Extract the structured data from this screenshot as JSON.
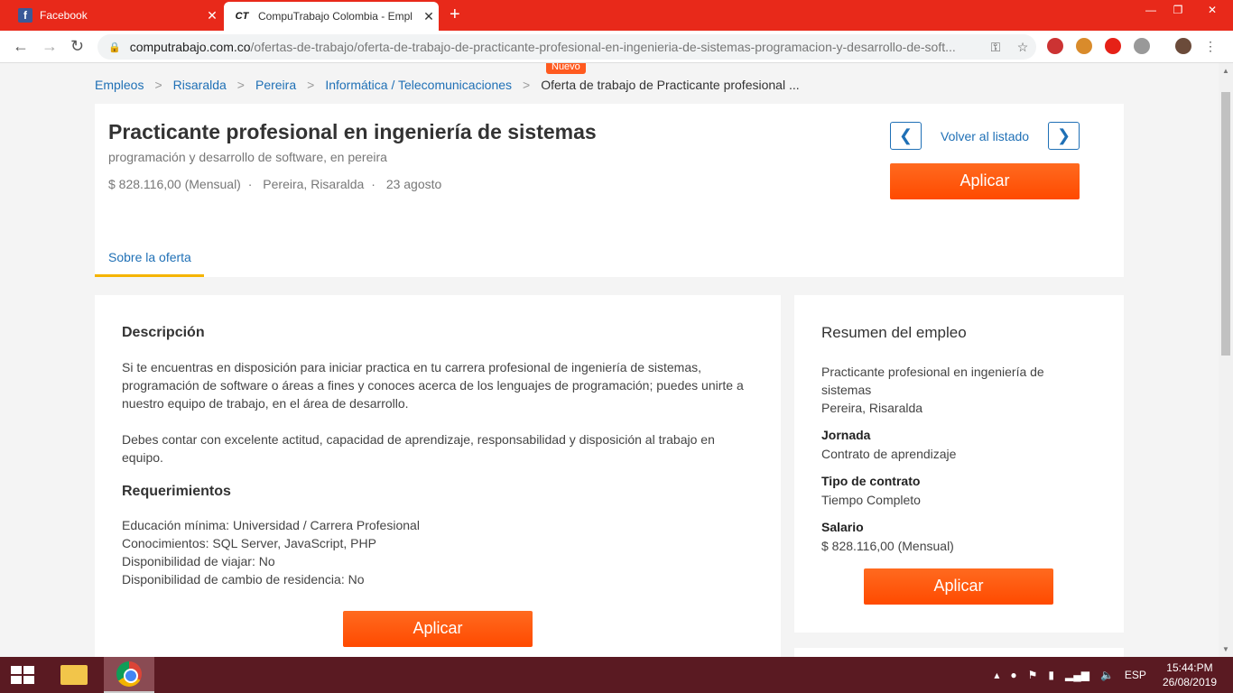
{
  "browser": {
    "tabs": [
      {
        "label": "Facebook",
        "favicon": "f"
      },
      {
        "label": "CompuTrabajo Colombia - Empl",
        "favicon": "CT"
      }
    ],
    "url_host": "computrabajo.com.co",
    "url_path": "/ofertas-de-trabajo/oferta-de-trabajo-de-practicante-profesional-en-ingenieria-de-sistemas-programacion-y-desarrollo-de-soft..."
  },
  "breadcrumb": {
    "items": [
      "Empleos",
      "Risaralda",
      "Pereira",
      "Informática / Telecomunicaciones"
    ],
    "current": "Oferta de trabajo de Practicante profesional ...",
    "badge": "Nuevo"
  },
  "job": {
    "title": "Practicante profesional en ingeniería de sistemas",
    "subtitle": "programación y desarrollo de software, en pereira",
    "salary": "$ 828.116,00 (Mensual)",
    "location": "Pereira, Risaralda",
    "date": "23 agosto",
    "sep": "·"
  },
  "nav": {
    "back_label": "Volver al listado"
  },
  "apply_label": "Aplicar",
  "tabs": {
    "about": "Sobre la oferta"
  },
  "description": {
    "heading": "Descripción",
    "p1": "Si te encuentras en disposición para iniciar practica en tu carrera profesional de ingeniería de sistemas, programación de software o áreas a fines y conoces acerca de los lenguajes de programación; puedes unirte a nuestro equipo de trabajo, en el área de desarrollo.",
    "p2": "Debes contar con excelente actitud, capacidad de aprendizaje, responsabilidad y disposición al trabajo en equipo.",
    "req_heading": "Requerimientos",
    "requirements": [
      "Educación mínima: Universidad / Carrera Profesional",
      "Conocimientos: SQL Server, JavaScript, PHP",
      "Disponibilidad de viajar: No",
      "Disponibilidad de cambio de residencia: No"
    ]
  },
  "summary": {
    "heading": "Resumen del empleo",
    "job": "Practicante profesional en ingeniería de sistemas",
    "location": "Pereira, Risaralda",
    "jornada_label": "Jornada",
    "jornada": "Contrato de aprendizaje",
    "contrato_label": "Tipo de contrato",
    "contrato": "Tiempo Completo",
    "salario_label": "Salario",
    "salario": "$ 828.116,00 (Mensual)"
  },
  "taskbar": {
    "lang": "ESP",
    "time": "15:44:PM",
    "date": "26/08/2019"
  },
  "colors": {
    "accent": "#ff5a1f",
    "link": "#1f70b6",
    "tab_underline": "#f5b400",
    "chrome_red": "#e8291a"
  }
}
